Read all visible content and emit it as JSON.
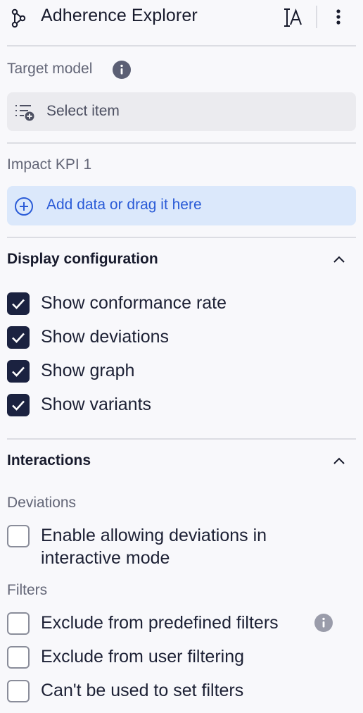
{
  "header": {
    "title": "Adherence Explorer",
    "icons": {
      "app": "process-graph-icon",
      "text_style": "text-style-icon",
      "more": "more-vertical-icon"
    }
  },
  "target_model": {
    "label": "Target model",
    "select_placeholder": "Select item"
  },
  "impact_kpi": {
    "label": "Impact KPI 1",
    "add_label": "Add data or drag it here"
  },
  "display_configuration": {
    "title": "Display configuration",
    "expanded": true,
    "options": [
      {
        "label": "Show conformance rate",
        "checked": true
      },
      {
        "label": "Show deviations",
        "checked": true
      },
      {
        "label": "Show graph",
        "checked": true
      },
      {
        "label": "Show variants",
        "checked": true
      }
    ]
  },
  "interactions": {
    "title": "Interactions",
    "expanded": true,
    "deviations": {
      "label": "Deviations",
      "option": {
        "label": "Enable allowing deviations in interactive mode",
        "checked": false
      }
    },
    "filters": {
      "label": "Filters",
      "options": [
        {
          "label": "Exclude from predefined filters",
          "checked": false,
          "has_info": true
        },
        {
          "label": "Exclude from user filtering",
          "checked": false
        },
        {
          "label": "Can't be used to set filters",
          "checked": false
        }
      ]
    }
  },
  "colors": {
    "checkbox_checked": "#1b2240",
    "accent_blue": "#2a5bd7",
    "add_box_bg": "#dbe8fb",
    "select_box_bg": "#ebebef"
  }
}
